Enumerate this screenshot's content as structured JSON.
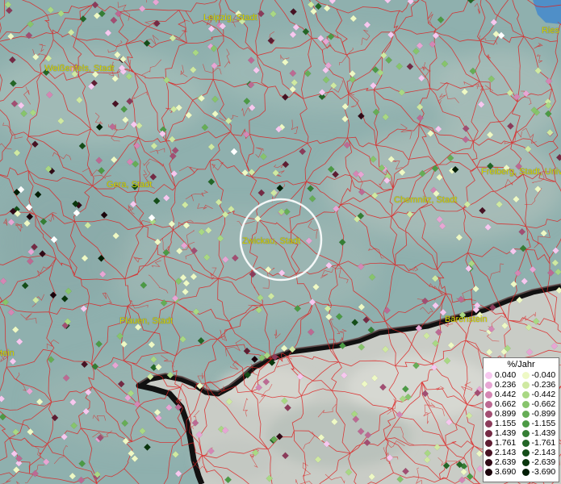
{
  "map": {
    "cities": [
      {
        "name": "Leipzig, Stadt"
      },
      {
        "name": "Weißenfels, Stadt"
      },
      {
        "name": "Gera, Stadt"
      },
      {
        "name": "Chemnitz, Stadt"
      },
      {
        "name": "Freiberg, Stadt, Univ"
      },
      {
        "name": "Zwickau, Stadt"
      },
      {
        "name": "Plauen, Stadt"
      },
      {
        "name": "Bärenstein"
      },
      {
        "name": "Ries"
      },
      {
        "name": "tein"
      }
    ],
    "colors": {
      "water": "#8fb0ae",
      "land_high": "#c9ccc6",
      "boundary": "#dd2222",
      "border": "#111111",
      "label": "#d8d800",
      "highlight_ring": "#ffffff"
    }
  },
  "legend": {
    "title": "%/Jahr",
    "positive": [
      {
        "label": "0.040",
        "color": "#f6c8ef"
      },
      {
        "label": "0.236",
        "color": "#e7a6d4"
      },
      {
        "label": "0.442",
        "color": "#d487b4"
      },
      {
        "label": "0.662",
        "color": "#bc6a93"
      },
      {
        "label": "0.899",
        "color": "#a24e72"
      },
      {
        "label": "1.155",
        "color": "#8b3b5a"
      },
      {
        "label": "1.439",
        "color": "#742a44"
      },
      {
        "label": "1.761",
        "color": "#5e1d32"
      },
      {
        "label": "2.143",
        "color": "#471223"
      },
      {
        "label": "2.639",
        "color": "#300a16"
      },
      {
        "label": "3.690",
        "color": "#1a030a"
      }
    ],
    "negative": [
      {
        "label": "-0.040",
        "color": "#eef9c5"
      },
      {
        "label": "-0.236",
        "color": "#cfe9a2"
      },
      {
        "label": "-0.442",
        "color": "#a9d884"
      },
      {
        "label": "-0.662",
        "color": "#87c46c"
      },
      {
        "label": "-0.899",
        "color": "#66ad56"
      },
      {
        "label": "-1.155",
        "color": "#4c9a45"
      },
      {
        "label": "-1.439",
        "color": "#357e34"
      },
      {
        "label": "-1.761",
        "color": "#236626"
      },
      {
        "label": "-2.143",
        "color": "#144d18"
      },
      {
        "label": "-2.639",
        "color": "#09350c"
      },
      {
        "label": "-3.690",
        "color": "#021e05"
      }
    ]
  }
}
